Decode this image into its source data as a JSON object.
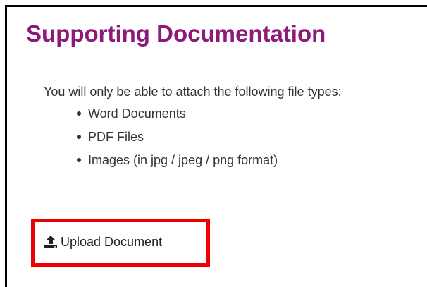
{
  "page": {
    "title": "Supporting Documentation",
    "title_color": "#8b1a7b",
    "intro": "You will only be able to attach the following file types:"
  },
  "file_types": [
    "Word Documents",
    "PDF Files",
    "Images (in jpg / jpeg / png format)"
  ],
  "upload": {
    "label": "Upload Document",
    "icon": "upload-icon",
    "highlight_color": "#ee0000"
  }
}
